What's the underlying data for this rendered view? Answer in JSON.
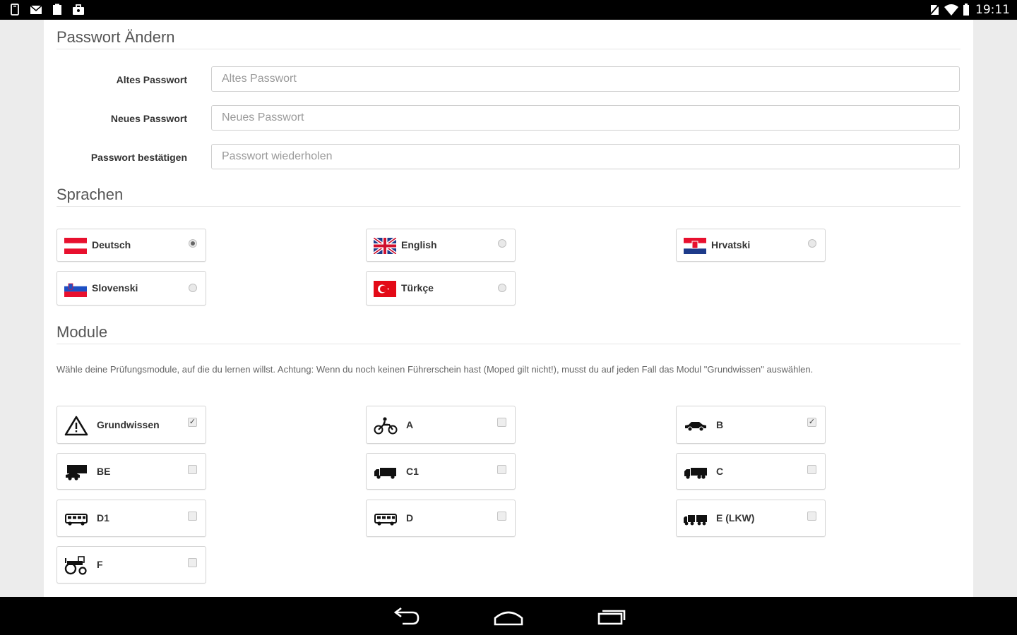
{
  "status_bar": {
    "time": "19:11",
    "left_icons": [
      "phone-icon",
      "mail-icon",
      "clipboard-icon",
      "bag-icon"
    ],
    "right_icons": [
      "no-sim-icon",
      "wifi-icon",
      "battery-icon"
    ]
  },
  "password": {
    "title": "Passwort Ändern",
    "fields": [
      {
        "label": "Altes Passwort",
        "placeholder": "Altes Passwort",
        "value": ""
      },
      {
        "label": "Neues Passwort",
        "placeholder": "Neues Passwort",
        "value": ""
      },
      {
        "label": "Passwort bestätigen",
        "placeholder": "Passwort wiederholen",
        "value": ""
      }
    ]
  },
  "languages": {
    "title": "Sprachen",
    "items": [
      {
        "label": "Deutsch",
        "selected": true,
        "flag": "austria-flag"
      },
      {
        "label": "English",
        "selected": false,
        "flag": "uk-flag"
      },
      {
        "label": "Hrvatski",
        "selected": false,
        "flag": "croatia-flag"
      },
      {
        "label": "Slovenski",
        "selected": false,
        "flag": "slovenia-flag"
      },
      {
        "label": "Türkçe",
        "selected": false,
        "flag": "turkey-flag"
      }
    ]
  },
  "modules": {
    "title": "Module",
    "hint": "Wähle deine Prüfungsmodule, auf die du lernen willst. Achtung: Wenn du noch keinen Führerschein hast (Moped gilt nicht!), musst du auf jeden Fall das Modul \"Grundwissen\" auswählen.",
    "items": [
      {
        "label": "Grundwissen",
        "checked": true,
        "icon": "warning-triangle-icon"
      },
      {
        "label": "A",
        "checked": false,
        "icon": "motorcycle-icon"
      },
      {
        "label": "B",
        "checked": true,
        "icon": "car-icon"
      },
      {
        "label": "BE",
        "checked": false,
        "icon": "car-trailer-icon"
      },
      {
        "label": "C1",
        "checked": false,
        "icon": "light-truck-icon"
      },
      {
        "label": "C",
        "checked": false,
        "icon": "truck-icon"
      },
      {
        "label": "D1",
        "checked": false,
        "icon": "minibus-icon"
      },
      {
        "label": "D",
        "checked": false,
        "icon": "bus-icon"
      },
      {
        "label": "E (LKW)",
        "checked": false,
        "icon": "truck-trailer-icon"
      },
      {
        "label": "F",
        "checked": false,
        "icon": "tractor-icon"
      }
    ]
  },
  "nav_bar": {
    "buttons": [
      "back-icon",
      "home-icon",
      "recent-apps-icon"
    ]
  },
  "colors": {
    "check_mark": "✓"
  }
}
